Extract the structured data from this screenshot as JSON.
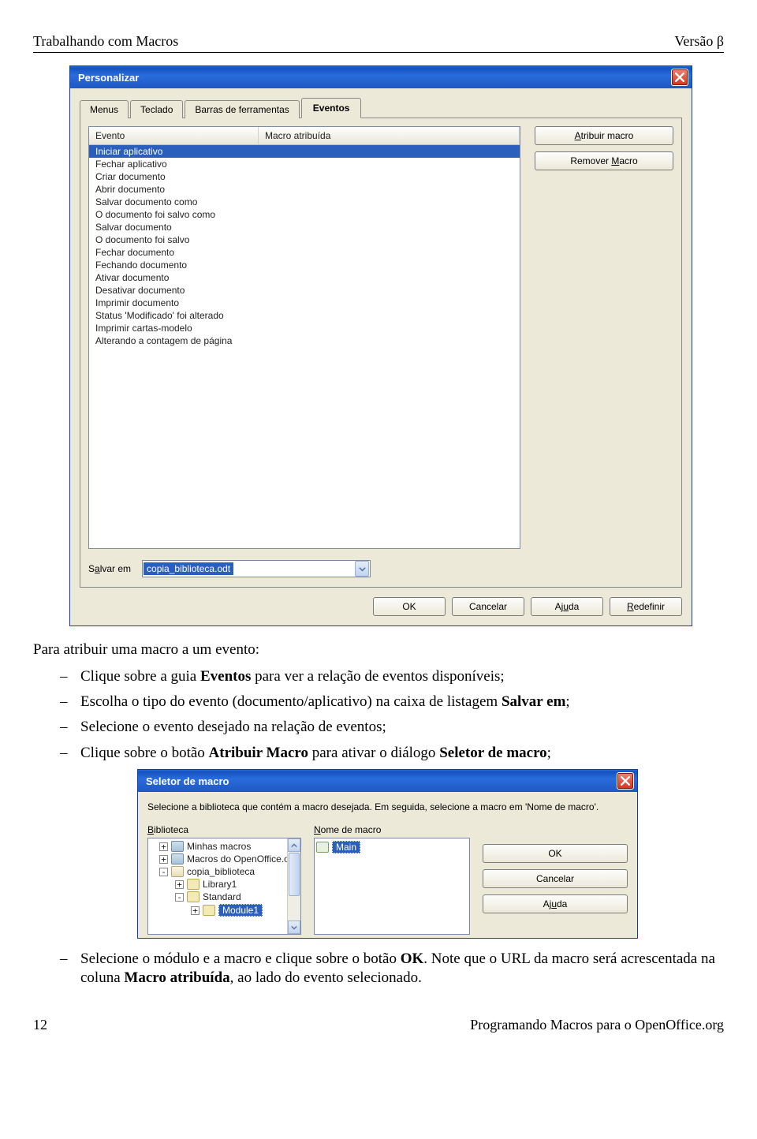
{
  "header": {
    "left": "Trabalhando com Macros",
    "right": "Versão  β"
  },
  "dialog1": {
    "title": "Personalizar",
    "tabs": [
      "Menus",
      "Teclado",
      "Barras de ferramentas",
      "Eventos"
    ],
    "active_tab_index": 3,
    "col_event": "Evento",
    "col_macro": "Macro atribuída",
    "events": [
      "Iniciar aplicativo",
      "Fechar aplicativo",
      "Criar documento",
      "Abrir documento",
      "Salvar documento como",
      "O documento foi salvo como",
      "Salvar documento",
      "O documento foi salvo",
      "Fechar documento",
      "Fechando documento",
      "Ativar documento",
      "Desativar documento",
      "Imprimir documento",
      "Status 'Modificado' foi alterado",
      "Imprimir cartas-modelo",
      "Alterando a contagem de página"
    ],
    "selected_event_index": 0,
    "btn_assign_pre": "A",
    "btn_assign_post": "tribuir macro",
    "btn_remove_pre": "Remover ",
    "btn_remove_u": "M",
    "btn_remove_post": "acro",
    "save_label_pre": "S",
    "save_label_u": "a",
    "save_label_post": "lvar em",
    "save_value": "copia_biblioteca.odt",
    "footer": {
      "ok": "OK",
      "cancel": "Cancelar",
      "help_pre": "Aj",
      "help_u": "u",
      "help_post": "da",
      "reset_u": "R",
      "reset_post": "edefinir"
    }
  },
  "paragraph_intro": "Para atribuir uma macro a um evento:",
  "bullets_top": [
    {
      "pre": "Clique sobre a guia ",
      "b": "Eventos",
      "post": " para ver a relação de eventos disponíveis;"
    },
    {
      "pre": "Escolha o tipo do evento (documento/aplicativo) na caixa de listagem ",
      "b": "Salvar em",
      "post": ";"
    },
    {
      "plain": "Selecione o evento desejado na relação de eventos;"
    },
    {
      "pre": "Clique sobre o botão ",
      "b": "Atribuir Macro",
      "post1": " para ativar o diálogo ",
      "b2": "Seletor de macro",
      "post2": ";"
    }
  ],
  "dialog2": {
    "title": "Seletor de macro",
    "desc": "Selecione a biblioteca que contém a macro desejada. Em seguida, selecione a macro em 'Nome de macro'.",
    "lbl_biblioteca_u": "B",
    "lbl_biblioteca_post": "iblioteca",
    "lbl_nome_u": "N",
    "lbl_nome_post": "ome de macro",
    "tree": {
      "minhas": "Minhas macros",
      "macros_oo": "Macros do OpenOffice.o",
      "copia": "copia_biblioteca",
      "library1": "Library1",
      "standard": "Standard",
      "module1": "Module1"
    },
    "main_macro": "Main",
    "btn_ok": "OK",
    "btn_cancel": "Cancelar",
    "btn_help_pre": "Aj",
    "btn_help_u": "u",
    "btn_help_post": "da"
  },
  "bullet_bottom": {
    "pre": "Selecione o módulo e a macro e clique sobre o botão ",
    "b1": "OK",
    "mid": ". Note que o URL da macro será acrescentada na coluna ",
    "b2": "Macro atribuída",
    "post": ", ao lado do evento selecionado."
  },
  "footer": {
    "left": "12",
    "right": "Programando Macros para o OpenOffice.org"
  }
}
